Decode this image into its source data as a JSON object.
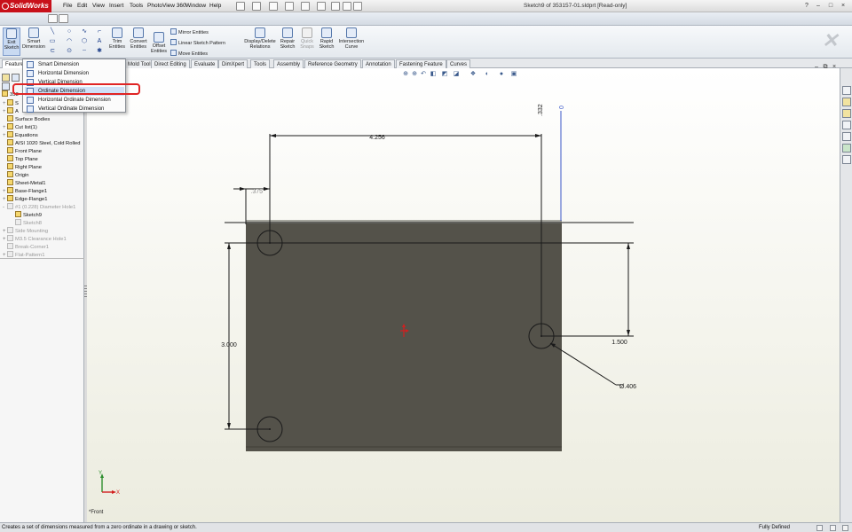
{
  "app": {
    "logo_text": "SolidWorks",
    "menu": [
      "File",
      "Edit",
      "View",
      "Insert",
      "Tools",
      "PhotoView 360",
      "Window",
      "Help"
    ],
    "document_title": "Sketch9 of 353157-01.sldprt [Read-only]"
  },
  "commands": {
    "exit_sketch": [
      "Exit",
      "Sketch"
    ],
    "smart_dimension": [
      "Smart",
      "Dimension"
    ],
    "trim_entities": [
      "Trim",
      "Entities"
    ],
    "convert_entities": [
      "Convert",
      "Entities"
    ],
    "offset_entities": [
      "Offset",
      "Entities"
    ],
    "mirror_entities": "Mirror Entities",
    "linear_sketch_pattern": "Linear Sketch Pattern",
    "move_entities": "Move Entities",
    "display_delete_relations": [
      "Display/Delete",
      "Relations"
    ],
    "repair_sketch": [
      "Repair",
      "Sketch"
    ],
    "quick_snaps": [
      "Quick",
      "Snaps"
    ],
    "rapid_sketch": [
      "Rapid",
      "Sketch"
    ],
    "intersection_curve": [
      "Intersection",
      "Curve"
    ]
  },
  "tabs": [
    "Feature",
    "Mold Tools",
    "Direct Editing",
    "Evaluate",
    "DimXpert",
    "Tools",
    "Assembly",
    "Reference Geometry",
    "Annotation",
    "Fastening Feature",
    "Curves"
  ],
  "dropdown": {
    "items": [
      "Smart Dimension",
      "Horizontal Dimension",
      "Vertical Dimension",
      "Ordinate Dimension",
      "Horizontal Ordinate Dimension",
      "Vertical Ordinate Dimension"
    ],
    "highlighted_index": 3
  },
  "tree": {
    "partial_top": [
      "353",
      "S",
      "A"
    ],
    "items": [
      {
        "label": "Surface Bodies",
        "plus": "",
        "dim": false
      },
      {
        "label": "Cut list(1)",
        "plus": "+",
        "dim": false
      },
      {
        "label": "Equations",
        "plus": "+",
        "dim": false
      },
      {
        "label": "AISI 1020 Steel, Cold Rolled",
        "plus": "",
        "dim": false
      },
      {
        "label": "Front Plane",
        "plus": "",
        "dim": false
      },
      {
        "label": "Top Plane",
        "plus": "",
        "dim": false
      },
      {
        "label": "Right Plane",
        "plus": "",
        "dim": false
      },
      {
        "label": "Origin",
        "plus": "",
        "dim": false
      },
      {
        "label": "Sheet-Metal1",
        "plus": "",
        "dim": false
      },
      {
        "label": "Base-Flange1",
        "plus": "+",
        "dim": false
      },
      {
        "label": "Edge-Flange1",
        "plus": "+",
        "dim": false
      },
      {
        "label": "#1 (0.228) Diameter Hole1",
        "plus": "-",
        "dim": true
      },
      {
        "label": "Sketch9",
        "plus": "",
        "dim": false
      },
      {
        "label": "Sketch8",
        "plus": "",
        "dim": true
      },
      {
        "label": "Side Mounting",
        "plus": "+",
        "dim": true
      },
      {
        "label": "M3.5 Clearance Hole1",
        "plus": "+",
        "dim": true
      },
      {
        "label": "Break-Corner1",
        "plus": "",
        "dim": true
      },
      {
        "label": "Flat-Pattern1",
        "plus": "+",
        "dim": true
      }
    ]
  },
  "drawing": {
    "dim_top_span": "4.256",
    "dim_left_offset": ".375",
    "dim_ordinate_vertical": ".332",
    "dim_ordinate_zero": "0",
    "dim_right_vertical": "1.500",
    "dim_left_vertical": "3.000",
    "dim_diameter": "Ø.406",
    "triad_x": "X",
    "triad_y": "Y",
    "plate_color": "#54524a",
    "plate_edge_color": "#a5a59d",
    "sketch_color": "#1a1a1a",
    "ordinate_color": "#3a56c8"
  },
  "viewport": {
    "view_name": "*Front"
  },
  "status": {
    "hint": "Creates a set of dimensions measured from a zero ordinate in a drawing or sketch.",
    "state": "Fully Defined"
  }
}
